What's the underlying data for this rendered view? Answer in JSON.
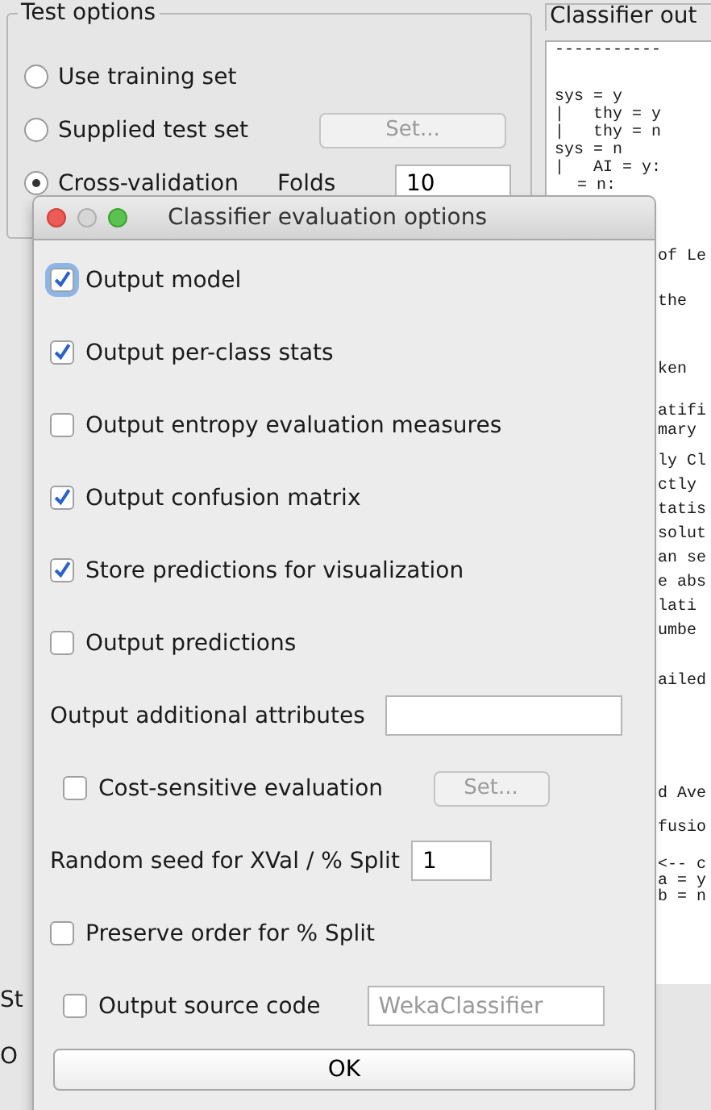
{
  "test_options": {
    "title": "Test options",
    "radios": [
      {
        "label": "Use training set",
        "selected": false
      },
      {
        "label": "Supplied test set",
        "selected": false,
        "button": {
          "label": "Set...",
          "disabled": true
        }
      },
      {
        "label": "Cross-validation",
        "selected": true,
        "field": {
          "label": "Folds",
          "value": "10"
        }
      }
    ]
  },
  "left_fragments": [
    "St",
    "O"
  ],
  "classifier_output": {
    "title": "Classifier out",
    "top_lines": [
      "-----------",
      "sys = y",
      "|   thy = y",
      "|   thy = n",
      "sys = n",
      "|   AI = y:"
    ],
    "partial_line": "= n:",
    "right_paragraphs": [
      [
        "of Le"
      ],
      [
        "the"
      ],
      [
        "ken"
      ],
      [
        "atifi",
        "mary"
      ],
      [
        "ly Cl",
        "ctly",
        "tatis",
        "solut",
        "an se",
        "e abs",
        "lati",
        "umbe"
      ],
      [
        "ailed"
      ],
      [
        "d Ave"
      ],
      [
        "fusio"
      ],
      [
        "<-- c",
        "a = y",
        "b = n"
      ]
    ]
  },
  "dialog": {
    "title": "Classifier evaluation options",
    "items": [
      {
        "kind": "check",
        "label": "Output model",
        "checked": true,
        "focused": true
      },
      {
        "kind": "check",
        "label": "Output per-class stats",
        "checked": true,
        "focused": false
      },
      {
        "kind": "check",
        "label": "Output entropy evaluation measures",
        "checked": false,
        "focused": false
      },
      {
        "kind": "check",
        "label": "Output confusion matrix",
        "checked": true,
        "focused": false
      },
      {
        "kind": "check",
        "label": "Store predictions for visualization",
        "checked": true,
        "focused": false
      },
      {
        "kind": "check",
        "label": "Output predictions",
        "checked": false,
        "focused": false
      },
      {
        "kind": "field",
        "label": "Output additional attributes",
        "wide": true
      },
      {
        "kind": "check_button",
        "label": "Cost-sensitive evaluation",
        "checked": false,
        "focused": false,
        "button": {
          "label": "Set...",
          "disabled": true
        }
      },
      {
        "kind": "field",
        "label": "Random seed for XVal / % Split",
        "value": "1",
        "wide": false
      },
      {
        "kind": "check",
        "label": "Preserve order for % Split",
        "checked": false,
        "focused": false
      },
      {
        "kind": "check_field",
        "label": "Output source code",
        "checked": false,
        "focused": false,
        "field": {
          "value": "WekaClassifier",
          "disabled": true
        }
      }
    ],
    "ok_button": "OK"
  }
}
